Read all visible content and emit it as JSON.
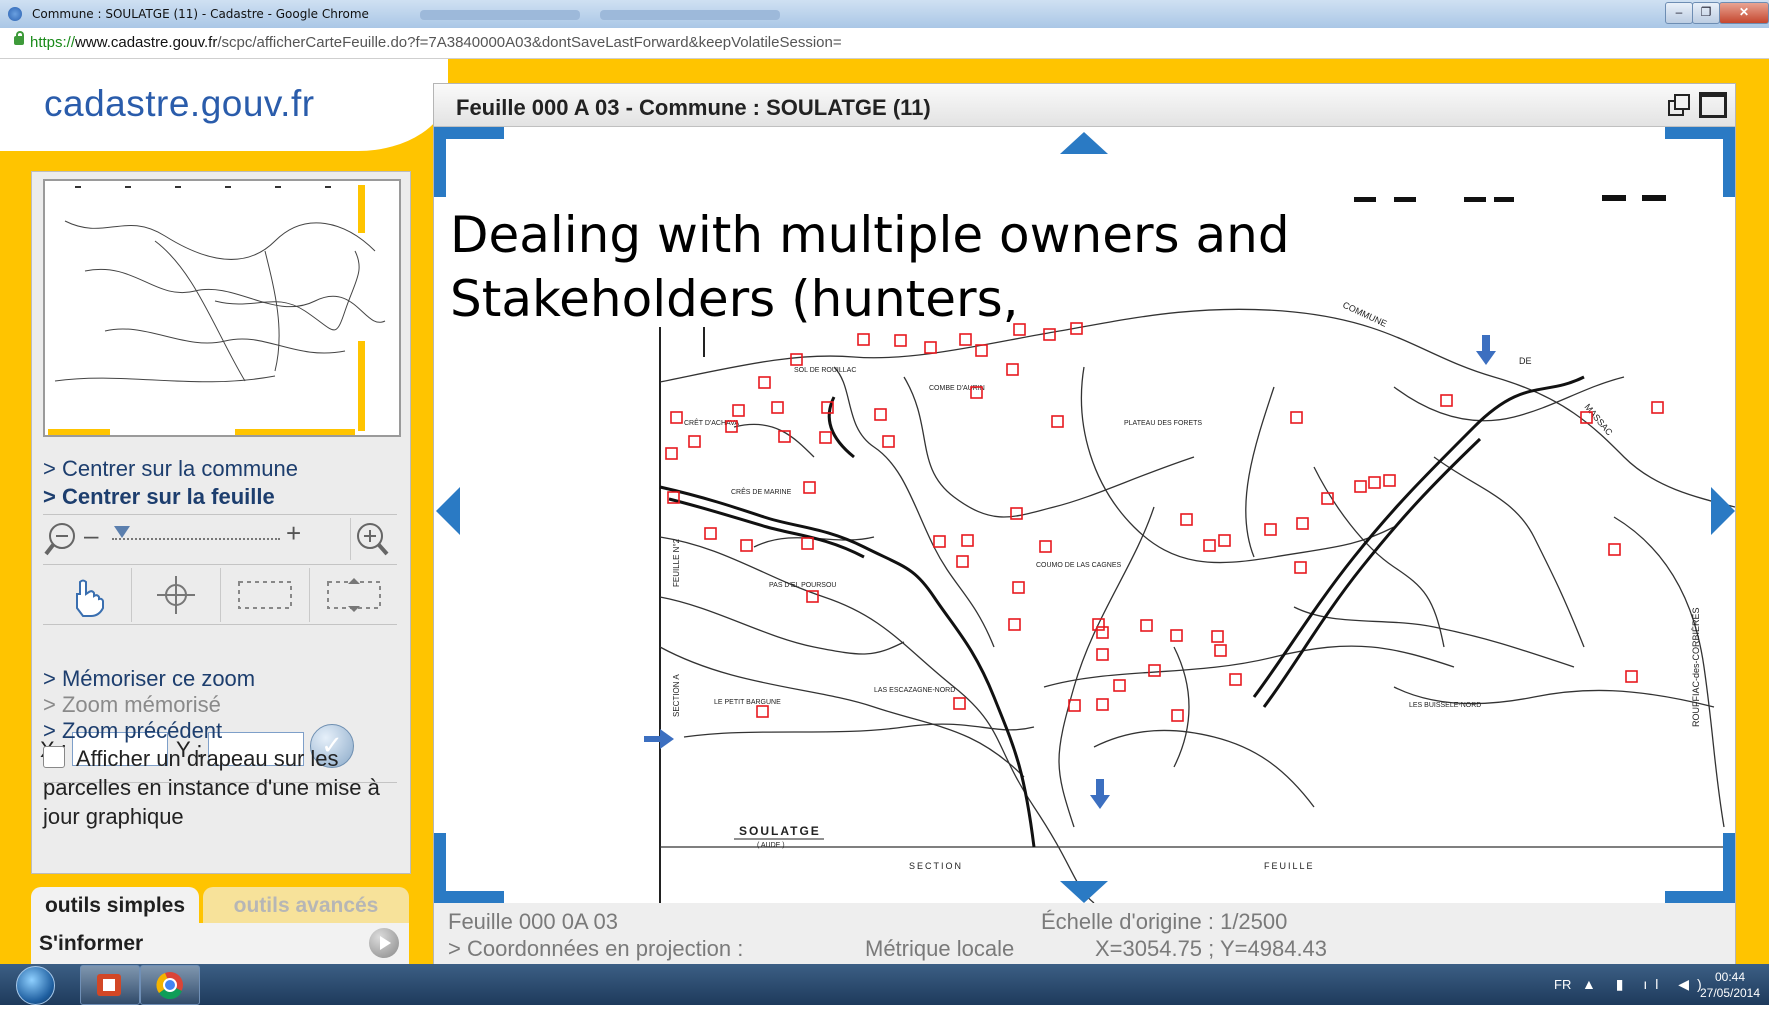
{
  "browser": {
    "tab_title": "Commune : SOULATGE (11) - Cadastre - Google Chrome",
    "url_scheme": "https://",
    "url_host": "www.cadastre.gouv.fr",
    "url_path": "/scpc/afficherCarteFeuille.do?f=7A3840000A03&dontSaveLastForward&keepVolatileSession=",
    "window_controls": [
      "–",
      "❐",
      "✕"
    ]
  },
  "site": {
    "logo": "cadastre.gouv.fr"
  },
  "left_panel": {
    "links": {
      "center_commune": "> Centrer sur la commune",
      "center_sheet": "> Centrer sur la feuille",
      "memorize_zoom": "> Mémoriser ce zoom",
      "memorized_zoom": "> Zoom mémorisé",
      "previous_zoom": "> Zoom précédent"
    },
    "zoom": {
      "minus": "–",
      "plus": "+",
      "level": 0.06
    },
    "coords": {
      "x_label": "X :",
      "y_label": "Y :",
      "x_value": "",
      "y_value": ""
    },
    "flag_option": {
      "checked": false,
      "label": "Afficher un drapeau sur les parcelles en instance d'une mise à jour graphique"
    },
    "tabs": {
      "simple": "outils simples",
      "advanced": "outils avancés"
    },
    "info_section": "S'informer"
  },
  "map_window": {
    "title": "Feuille 000 A 03 - Commune : SOULATGE (11)",
    "overlay_text": [
      "Dealing with multiple owners and",
      "Stakeholders (hunters,"
    ],
    "map_labels": {
      "sheet_name": "SOULATGE",
      "sheet_sub": "( AUDE )",
      "section": "SECTION",
      "feuille": "FEUILLE",
      "places": [
        "SOL DE ROUILLAC",
        "CRÊT D'ACHAVA",
        "COMBE D'AURIN",
        "PLATEAU DES FORETS",
        "CRÊS DE MARINE",
        "PAS D'EL POURSOU",
        "COUMO DE LAS CAGNES",
        "LE PETIT BARGUNE",
        "LAS ESCAZAGNE-NORD",
        "LES BUISSELE-NORD",
        "COMMUNE",
        "DE",
        "MASSAC",
        "ROUFFIAC-des-CORBIÈRES",
        "FEUILLE N°2",
        "SECTION A"
      ]
    },
    "footer": {
      "sheet": "Feuille 000 0A 03",
      "scale": "Échelle d'origine : 1/2500",
      "projection": "> Coordonnées en projection :",
      "metric": "Métrique locale",
      "coords": "X=3054.75 ; Y=4984.43"
    }
  },
  "taskbar": {
    "lang": "FR",
    "time": "00:44",
    "date": "27/05/2014",
    "apps": [
      "powerpoint-icon",
      "chrome-icon"
    ]
  },
  "colors": {
    "brand_yellow": "#ffc400",
    "logo_blue": "#2a5cab",
    "nav_blue": "#2a7ac4",
    "marker_red": "#e8191f"
  }
}
